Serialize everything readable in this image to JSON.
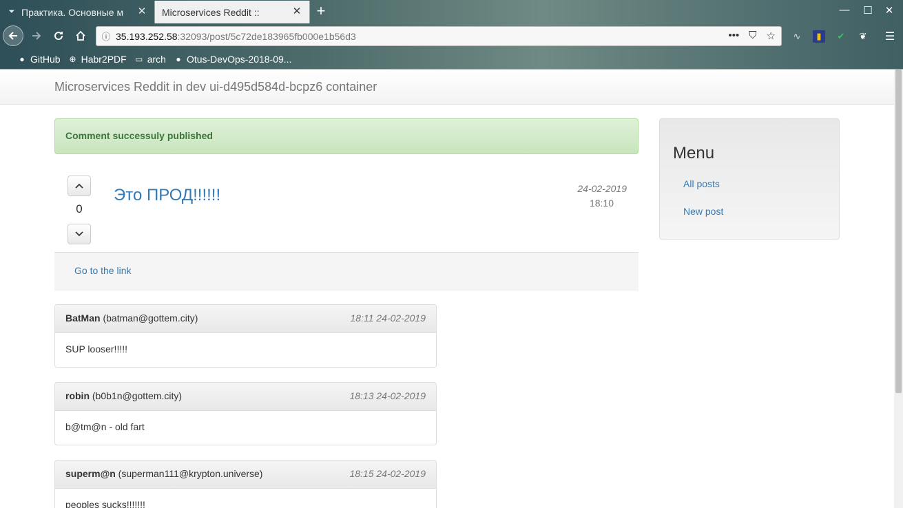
{
  "browser": {
    "tabs": [
      {
        "title": "Практика. Основные м",
        "active": false
      },
      {
        "title": "Microservices Reddit ::",
        "active": true
      }
    ],
    "new_tab": "+",
    "url": {
      "host": "35.193.252.58",
      "path": ":32093/post/5c72de183965fb000e1b56d3"
    },
    "bookmarks": [
      {
        "label": "GitHub",
        "icon": "github-icon"
      },
      {
        "label": "Habr2PDF",
        "icon": "globe-icon"
      },
      {
        "label": "arch",
        "icon": "folder-icon"
      },
      {
        "label": "Otus-DevOps-2018-09...",
        "icon": "github-icon"
      }
    ]
  },
  "site": {
    "brand": "Microservices Reddit in dev ui-d495d584d-bcpz6 container"
  },
  "alert": {
    "message": "Comment successuly published"
  },
  "post": {
    "votes": "0",
    "title": "Это ПРОД!!!!!!",
    "date": "24-02-2019",
    "time": "18:10",
    "link_label": "Go to the link"
  },
  "comments": [
    {
      "name": "BatMan",
      "email": "(batman@gottem.city)",
      "time": "18:11 24-02-2019",
      "body": "SUP looser!!!!!"
    },
    {
      "name": "robin",
      "email": "(b0b1n@gottem.city)",
      "time": "18:13 24-02-2019",
      "body": "b@tm@n - old fart"
    },
    {
      "name": "superm@n",
      "email": "(superman111@krypton.universe)",
      "time": "18:15 24-02-2019",
      "body": "peoples sucks!!!!!!!"
    }
  ],
  "menu": {
    "title": "Menu",
    "items": [
      "All posts",
      "New post"
    ]
  },
  "colors": {
    "link": "#337ab7",
    "alert_text": "#3c763d",
    "alert_bg": "#dff0d8"
  }
}
